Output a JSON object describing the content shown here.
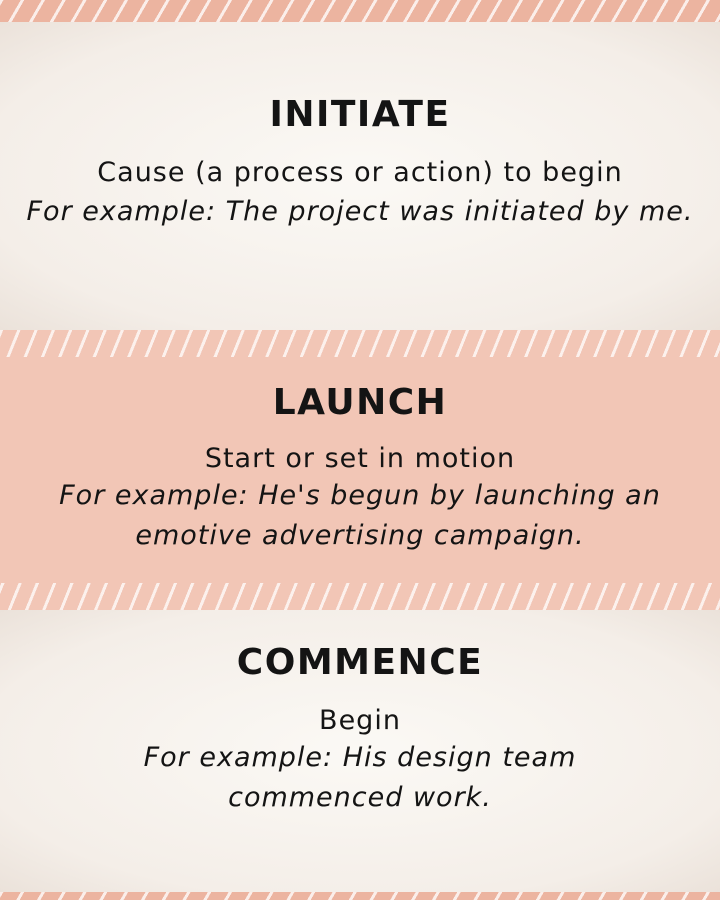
{
  "entries": [
    {
      "term": "INITIATE",
      "definition": "Cause (a process or action) to begin",
      "example": "For example: The project was initiated by me."
    },
    {
      "term": "LAUNCH",
      "definition": "Start or set in motion",
      "example": "For example: He's begun by launching an emotive advertising campaign."
    },
    {
      "term": "COMMENCE",
      "definition": "Begin",
      "example": "For example: His design team commenced work."
    }
  ],
  "colors": {
    "background": "#f6f1ec",
    "accent_pink": "#f2c6b6",
    "stripe": "#ecb4a0",
    "text": "#141414"
  }
}
